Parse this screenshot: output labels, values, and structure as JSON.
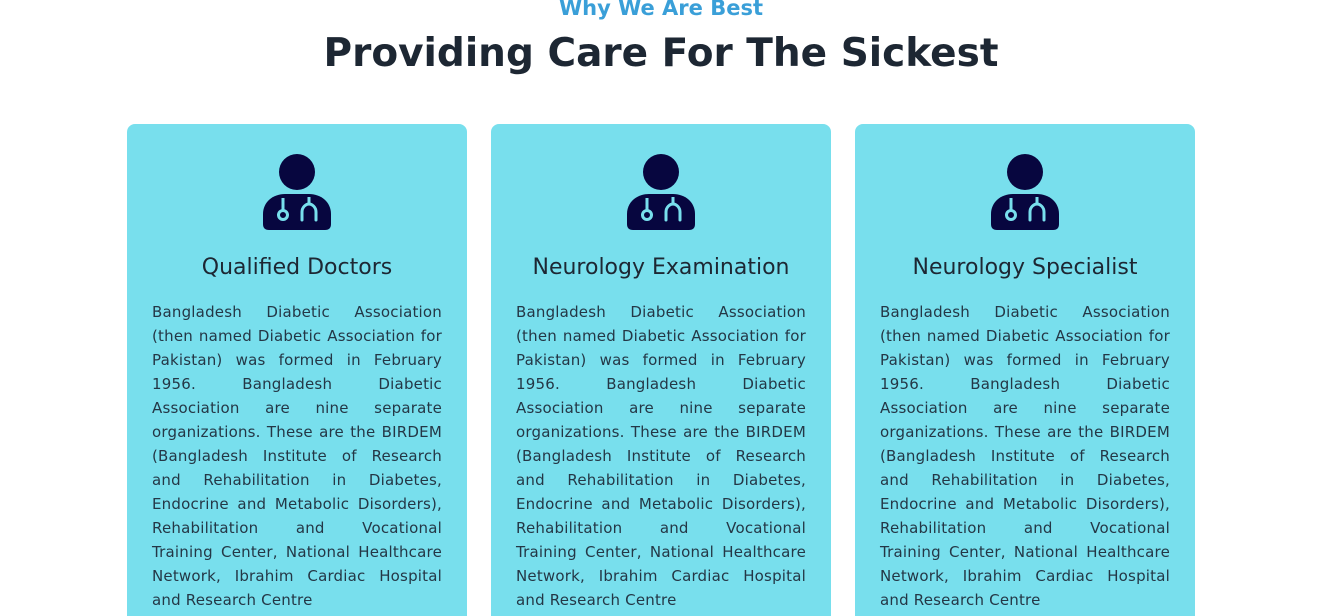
{
  "section": {
    "eyebrow": "Why We Are Best",
    "title": "Providing Care For The Sickest"
  },
  "colors": {
    "eyebrow": "#3a9fd8",
    "card_background": "#78dfed",
    "icon": "#07063f",
    "heading": "#1d2733"
  },
  "cards": [
    {
      "icon": "doctor-stethoscope-icon",
      "title": "Qualified Doctors",
      "text": "Bangladesh Diabetic Association (then named Diabetic Association for Pakistan) was formed in February 1956. Bangladesh Diabetic Association are nine separate organizations. These are the BIRDEM (Bangladesh Institute of Research and Rehabilitation in Diabetes, Endocrine and Metabolic Disorders), Rehabilitation and Vocational Training Center, National Healthcare Network, Ibrahim Cardiac Hospital and Research Centre"
    },
    {
      "icon": "doctor-stethoscope-icon",
      "title": "Neurology Examination",
      "text": "Bangladesh Diabetic Association (then named Diabetic Association for Pakistan) was formed in February 1956. Bangladesh Diabetic Association are nine separate organizations. These are the BIRDEM (Bangladesh Institute of Research and Rehabilitation in Diabetes, Endocrine and Metabolic Disorders), Rehabilitation and Vocational Training Center, National Healthcare Network, Ibrahim Cardiac Hospital and Research Centre"
    },
    {
      "icon": "doctor-stethoscope-icon",
      "title": "Neurology Specialist",
      "text": "Bangladesh Diabetic Association (then named Diabetic Association for Pakistan) was formed in February 1956. Bangladesh Diabetic Association are nine separate organizations. These are the BIRDEM (Bangladesh Institute of Research and Rehabilitation in Diabetes, Endocrine and Metabolic Disorders), Rehabilitation and Vocational Training Center, National Healthcare Network, Ibrahim Cardiac Hospital and Research Centre"
    }
  ]
}
